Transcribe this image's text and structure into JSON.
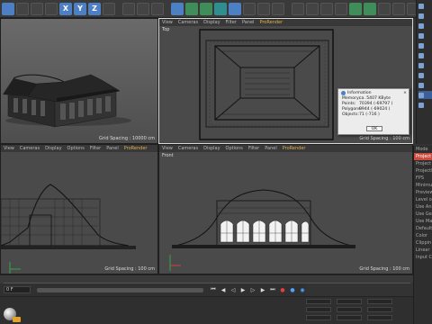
{
  "toolbar": {
    "axis_buttons": [
      "X",
      "Y",
      "Z"
    ]
  },
  "viewports": {
    "perspective": {
      "grid_spacing": "Grid Spacing : 10000 cm"
    },
    "top": {
      "menu": [
        "View",
        "Cameras",
        "Display",
        "Filter",
        "Panel",
        "ProRender"
      ],
      "name": "Top",
      "grid_spacing": "Grid Spacing : 100 cm"
    },
    "right": {
      "menu": [
        "View",
        "Cameras",
        "Display",
        "Options",
        "Filter",
        "Panel",
        "ProRender"
      ],
      "grid_spacing": "Grid Spacing : 100 cm"
    },
    "front": {
      "menu": [
        "View",
        "Cameras",
        "Display",
        "Options",
        "Filter",
        "Panel",
        "ProRender"
      ],
      "name": "Front",
      "grid_spacing": "Grid Spacing : 100 cm"
    }
  },
  "info_dialog": {
    "title": "Information",
    "rows": [
      {
        "key": "Memory:",
        "value": "ca. 5407 KByte"
      },
      {
        "key": "Points:",
        "value": "70394 (-69797 )"
      },
      {
        "key": "Polygons:",
        "value": "9944 (-69024 )"
      },
      {
        "key": "Objects:",
        "value": "71 (-716 )"
      }
    ],
    "ok_label": "OK"
  },
  "transport": {
    "frame_field": "0 F"
  },
  "attributes": {
    "rows": [
      "Mode",
      "Project S",
      "Project Se",
      "ProjectI",
      "FPS",
      "Minimu",
      "Preview",
      "Level of",
      "Use Ani",
      "Use Ge",
      "Use Ma",
      "Default",
      "Color",
      "Clippin",
      "Linear",
      "Input C"
    ]
  },
  "colors": {
    "accent_prorender": "#e3b04b",
    "selection": "#3b5f96",
    "record_red": "#e04040",
    "material_tag": "#e3a22b"
  }
}
